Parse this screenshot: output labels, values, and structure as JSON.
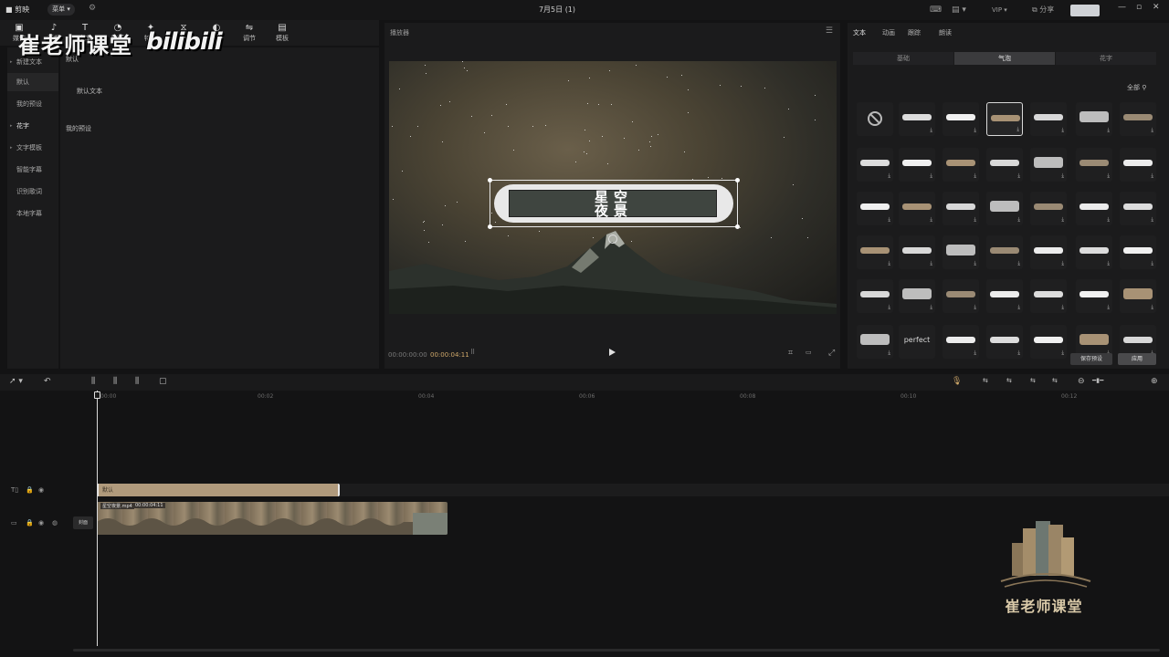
{
  "titlebar": {
    "app_name": "■ 剪映",
    "menu_label": "菜单 ▾",
    "document_title": "7月5日 (1)",
    "export_label": "",
    "icons": [
      "keyboard-icon",
      "layout-icon",
      "vip-icon",
      "share-icon"
    ]
  },
  "brand_overlay": {
    "text_cn": "崔老师课堂",
    "text_logo": "bilibili"
  },
  "tools": [
    {
      "label": "媒体",
      "icon": "▣"
    },
    {
      "label": "音频",
      "icon": "♪"
    },
    {
      "label": "文本",
      "icon": "T"
    },
    {
      "label": "贴纸",
      "icon": "◔"
    },
    {
      "label": "特效",
      "icon": "✦"
    },
    {
      "label": "转场",
      "icon": "⧖"
    },
    {
      "label": "滤镜",
      "icon": "◐"
    },
    {
      "label": "调节",
      "icon": "⇋"
    },
    {
      "label": "模板",
      "icon": "▤"
    }
  ],
  "sidebar": {
    "items": [
      {
        "label": "新建文本",
        "arrow": true
      },
      {
        "label": "默认"
      },
      {
        "label": "我的预设"
      },
      {
        "label": "花字",
        "arrow": true
      },
      {
        "label": "文字模板",
        "arrow": true
      },
      {
        "label": "智能字幕"
      },
      {
        "label": "识别歌词"
      },
      {
        "label": "本地字幕"
      }
    ]
  },
  "left_content": {
    "section1": "默认",
    "default_text": "默认文本",
    "section2": "我的预设"
  },
  "player": {
    "title": "播放器",
    "caption_line1": "星空",
    "caption_line2": "夜景",
    "timecode_current": "00:00:00:00",
    "timecode_total": "00:00:04:11"
  },
  "right_panel": {
    "tabs": [
      "文本",
      "动画",
      "跟踪",
      "朗读"
    ],
    "segments": [
      "基础",
      "气泡",
      "花字"
    ],
    "selected_segment": 1,
    "filter_label": "全部 ⚲",
    "grid_special_text": "perfect",
    "save_preset": "保存预设",
    "apply_all": "应用"
  },
  "timeline": {
    "ticks": [
      "00:00",
      "00:02",
      "00:04",
      "00:06",
      "00:08",
      "00:10",
      "00:12"
    ],
    "text_clip_label": "默认",
    "video_clip_label": "星空夜景.mp4",
    "video_clip_label2": "00:00:04:11",
    "cover_label": "封面"
  },
  "watermark": {
    "text": "崔老师课堂"
  }
}
